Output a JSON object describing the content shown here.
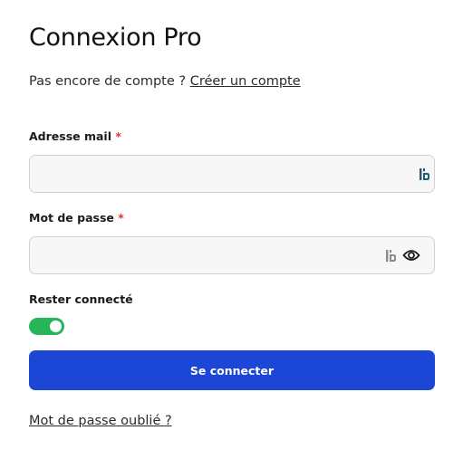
{
  "form": {
    "title": "Connexion Pro",
    "signup_prompt": "Pas encore de compte ?",
    "signup_link": "Créer un compte",
    "email": {
      "label": "Adresse mail",
      "required_mark": "*",
      "value": "",
      "placeholder": ""
    },
    "password": {
      "label": "Mot de passe",
      "required_mark": "*",
      "value": "",
      "placeholder": ""
    },
    "remember": {
      "label": "Rester connecté",
      "checked": true
    },
    "submit_label": "Se connecter",
    "forgot_link": "Mot de passe oublié ?"
  },
  "icons": {
    "email_field_icon": "password-manager-icon",
    "password_field_icon": "password-manager-icon",
    "password_visibility_icon": "eye-icon"
  },
  "colors": {
    "primary_button": "#1c46d6",
    "toggle_on": "#27b55a",
    "required_asterisk": "#e5352b",
    "password_manager_icon_active": "#1f5c77"
  }
}
